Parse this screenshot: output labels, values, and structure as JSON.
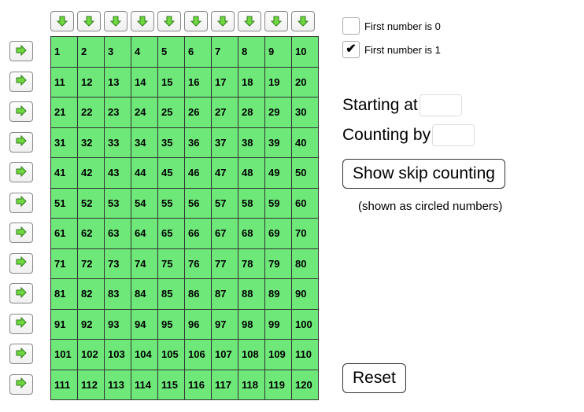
{
  "checkboxes": {
    "first0": {
      "label": "First number is 0",
      "checked": false
    },
    "first1": {
      "label": "First number is 1",
      "checked": true
    }
  },
  "controls": {
    "starting_label": "Starting at",
    "counting_label": "Counting by",
    "starting_value": "",
    "counting_value": "",
    "show_button": "Show skip counting",
    "hint": "(shown as circled numbers)",
    "reset_button": "Reset"
  },
  "grid": {
    "rows": [
      [
        "1",
        "2",
        "3",
        "4",
        "5",
        "6",
        "7",
        "8",
        "9",
        "10"
      ],
      [
        "11",
        "12",
        "13",
        "14",
        "15",
        "16",
        "17",
        "18",
        "19",
        "20"
      ],
      [
        "21",
        "22",
        "23",
        "24",
        "25",
        "26",
        "27",
        "28",
        "29",
        "30"
      ],
      [
        "31",
        "32",
        "33",
        "34",
        "35",
        "36",
        "37",
        "38",
        "39",
        "40"
      ],
      [
        "41",
        "42",
        "43",
        "44",
        "45",
        "46",
        "47",
        "48",
        "49",
        "50"
      ],
      [
        "51",
        "52",
        "53",
        "54",
        "55",
        "56",
        "57",
        "58",
        "59",
        "60"
      ],
      [
        "61",
        "62",
        "63",
        "64",
        "65",
        "66",
        "67",
        "68",
        "69",
        "70"
      ],
      [
        "71",
        "72",
        "73",
        "74",
        "75",
        "76",
        "77",
        "78",
        "79",
        "80"
      ],
      [
        "81",
        "82",
        "83",
        "84",
        "85",
        "86",
        "87",
        "88",
        "89",
        "90"
      ],
      [
        "91",
        "92",
        "93",
        "94",
        "95",
        "96",
        "97",
        "98",
        "99",
        "100"
      ],
      [
        "101",
        "102",
        "103",
        "104",
        "105",
        "106",
        "107",
        "108",
        "109",
        "110"
      ],
      [
        "111",
        "112",
        "113",
        "114",
        "115",
        "116",
        "117",
        "118",
        "119",
        "120"
      ]
    ]
  },
  "colors": {
    "cell_bg": "#6fe87a",
    "arrow_fill": "#6fd83f",
    "arrow_stroke": "#2f7a1f"
  }
}
